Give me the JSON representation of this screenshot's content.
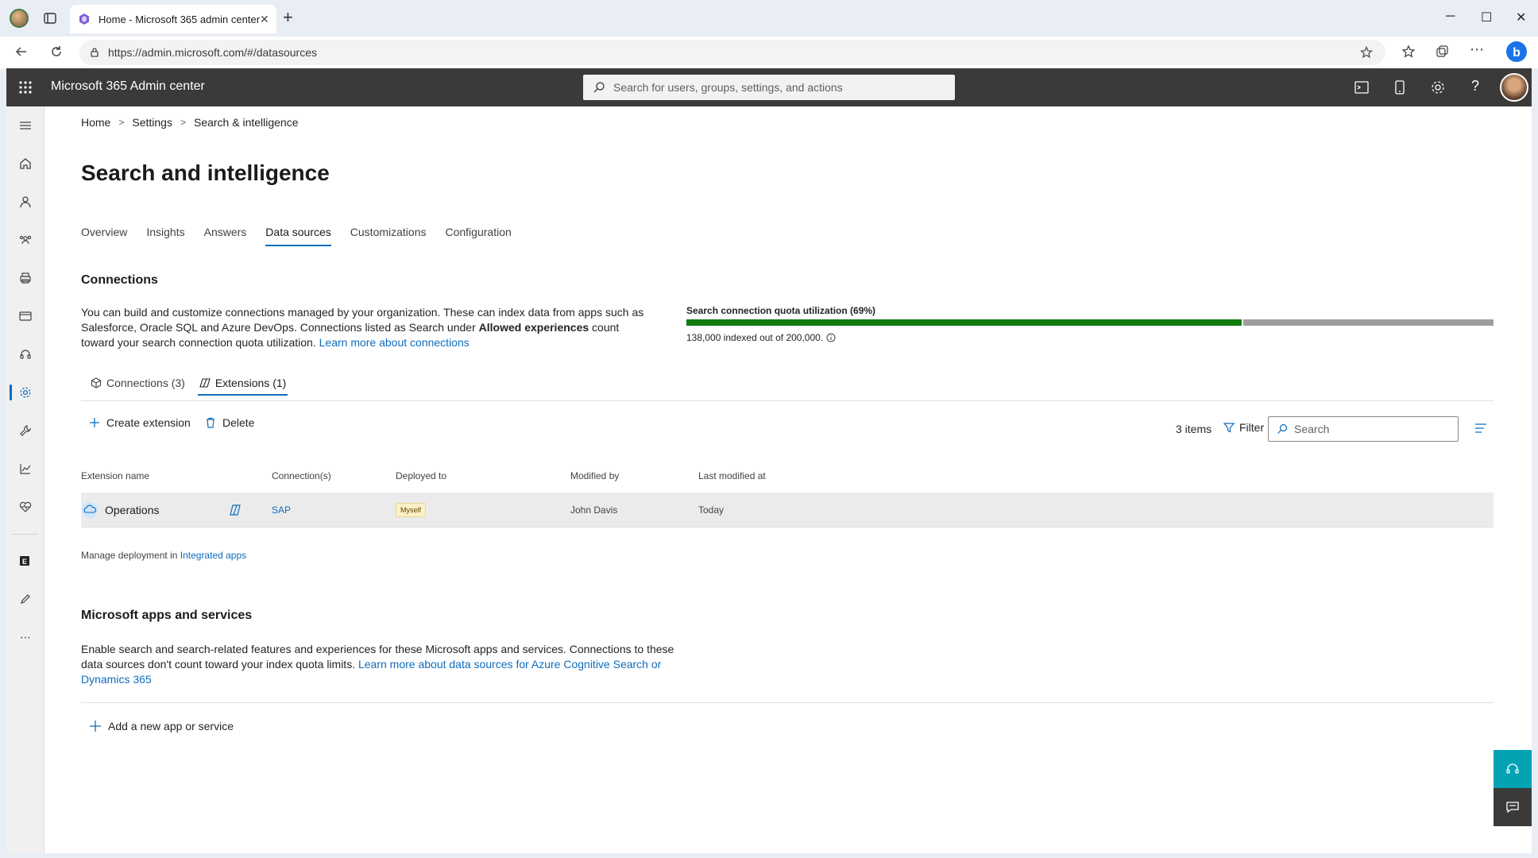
{
  "browser": {
    "tab_title": "Home - Microsoft 365 admin center",
    "url": "https://admin.microsoft.com/#/datasources"
  },
  "suite": {
    "app_title": "Microsoft 365 Admin center",
    "search_placeholder": "Search for users, groups, settings, and actions"
  },
  "breadcrumb": {
    "home": "Home",
    "settings": "Settings",
    "current": "Search & intelligence"
  },
  "page": {
    "title": "Search and intelligence",
    "tabs": [
      "Overview",
      "Insights",
      "Answers",
      "Data sources",
      "Customizations",
      "Configuration"
    ],
    "active_tab": "Data sources"
  },
  "connections": {
    "title": "Connections",
    "desc_part1": "You can build and customize connections managed by your organization. These can index data from apps such as Salesforce, Oracle SQL and Azure DevOps. Connections listed as Search under ",
    "desc_bold": "Allowed experiences",
    "desc_part2": " count toward your search connection quota utilization. ",
    "desc_link": "Learn more about connections",
    "quota_label": "Search connection quota utilization (69%)",
    "quota_fraction": 0.69,
    "quota_sub": "138,000 indexed out of 200,000.",
    "subtabs": [
      "Connections (3)",
      "Extensions (1)"
    ],
    "active_subtab": "Extensions (1)"
  },
  "commands": {
    "create": "Create extension",
    "delete": "Delete",
    "items": "3 items",
    "filter": "Filter",
    "search_placeholder": "Search"
  },
  "table": {
    "columns": [
      "Extension name",
      "Connection(s)",
      "Deployed to",
      "Modified by",
      "Last modified at"
    ],
    "rows": [
      {
        "name": "Operations",
        "connection": "SAP",
        "deployed": "Myself",
        "modified_by": "John Davis",
        "modified_at": "Today"
      }
    ]
  },
  "manage": {
    "text": "Manage deployment in ",
    "link": "Integrated apps"
  },
  "apps": {
    "title": "Microsoft apps and services",
    "desc": "Enable search and search-related features and experiences for these Microsoft apps and services. Connections to these data sources don't count toward your index quota limits. ",
    "desc_link": "Learn more about data sources for Azure Cognitive Search or Dynamics 365",
    "add": "Add a new app or service"
  },
  "colors": {
    "accent": "#0f6cbd",
    "quota_fill": "#107c10",
    "suite_bar": "#3b3a39"
  }
}
